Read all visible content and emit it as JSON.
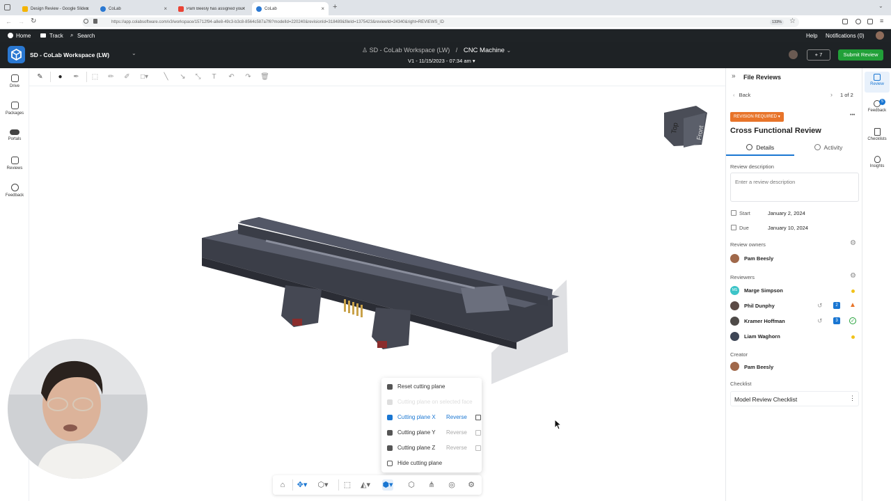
{
  "browser": {
    "tabs": [
      {
        "label": "Design Review - Google Slides"
      },
      {
        "label": "CoLab"
      },
      {
        "label": "Pam Beesly has assigned you t"
      },
      {
        "label": "CoLab"
      }
    ],
    "new_tab_label": "+",
    "url": "https://app.colabsoftware.com/v3/workspace/15712f94-a8e8-49c3-b3c8-8564c587a7f6?modelId=220240&revisionId=318489&fileId=1375423&reviewId=24340&right=REVIEWS_ID",
    "zoom": "133%"
  },
  "appnav": {
    "home": "Home",
    "track": "Track",
    "search": "Search",
    "help": "Help",
    "notifications": "Notifications (0)"
  },
  "header": {
    "workspace": "SD - CoLab Workspace (LW)",
    "breadcrumb_workspace": "SD - CoLab Workspace (LW)",
    "breadcrumb_sep": "/",
    "file_name": "CNC Machine",
    "version": "V1 - 11/15/2023 - 07:34 am",
    "invite_count": "+ 7",
    "submit_label": "Submit Review"
  },
  "leftrail": {
    "items": [
      {
        "label": "Drive"
      },
      {
        "label": "Packages"
      },
      {
        "label": "Portals"
      },
      {
        "label": "Reviews"
      },
      {
        "label": "Feedback"
      }
    ]
  },
  "viewcube": {
    "top": "Top",
    "front": "Front"
  },
  "menu": {
    "items": [
      {
        "label": "Reset cutting plane"
      },
      {
        "label": "Cutting plane on selected face"
      },
      {
        "label": "Cutting plane X",
        "reverse": "Reverse"
      },
      {
        "label": "Cutting plane Y",
        "reverse": "Reverse"
      },
      {
        "label": "Cutting plane Z",
        "reverse": "Reverse"
      },
      {
        "label": "Hide cutting plane"
      }
    ]
  },
  "panel": {
    "title": "File Reviews",
    "back": "Back",
    "pager": "1 of 2",
    "status_badge": "REVISION REQUIRED",
    "more": "•••",
    "review_title": "Cross Functional Review",
    "tabs": {
      "details": "Details",
      "activity": "Activity"
    },
    "description_label": "Review description",
    "description_placeholder": "Enter a review description",
    "start_label": "Start",
    "start_value": "January 2, 2024",
    "due_label": "Due",
    "due_value": "January 10, 2024",
    "owners_label": "Review owners",
    "owner": "Pam Beesly",
    "reviewers_label": "Reviewers",
    "reviewers": [
      {
        "name": "Marge Simpson",
        "initials": "MS",
        "count": ""
      },
      {
        "name": "Phil Dunphy",
        "initials": "",
        "count": "2"
      },
      {
        "name": "Kramer Hoffman",
        "initials": "",
        "count": "3"
      },
      {
        "name": "Liam Waghorn",
        "initials": "",
        "count": ""
      }
    ],
    "creator_label": "Creator",
    "creator": "Pam Beesly",
    "checklist_label": "Checklist",
    "checklist_name": "Model Review Checklist"
  },
  "rightrail": {
    "items": [
      {
        "label": "Review"
      },
      {
        "label": "Feedback",
        "badge": "5"
      },
      {
        "label": "Checklists"
      },
      {
        "label": "Insights"
      }
    ]
  },
  "colors": {
    "accent": "#1976d2",
    "submit": "#21a038",
    "status": "#e8742a",
    "app_bg": "#1e2225"
  }
}
